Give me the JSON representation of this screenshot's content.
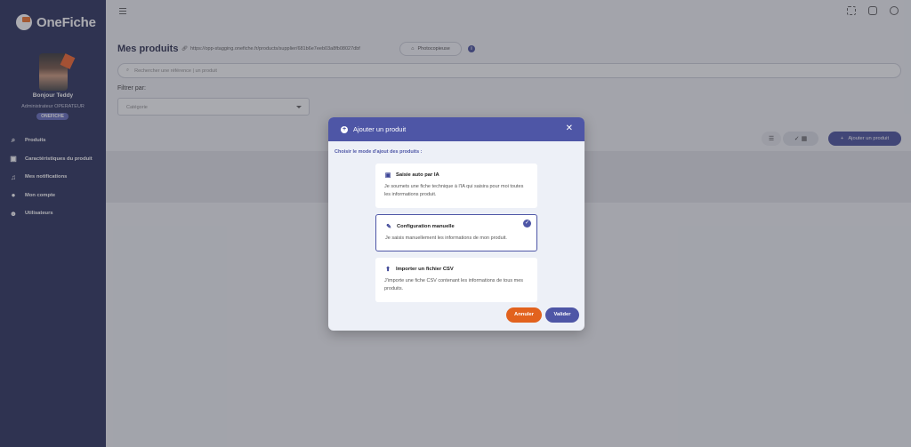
{
  "app": {
    "logo_text": "OneFiche"
  },
  "user": {
    "greeting": "Bonjour Teddy",
    "role": "Administrateur OPERATEUR",
    "company": "ONEFICHE"
  },
  "sidebar": {
    "items": [
      {
        "label": "Produits",
        "icon": "search-icon"
      },
      {
        "label": "Caractéristiques du produit",
        "icon": "box-icon"
      },
      {
        "label": "Mes notifications",
        "icon": "bell-icon"
      },
      {
        "label": "Mon compte",
        "icon": "user-icon"
      },
      {
        "label": "Utilisateurs",
        "icon": "users-icon"
      }
    ]
  },
  "page": {
    "title": "Mes produits",
    "url": "https://opp-stagging.onefiche.fr/products/supplier/681b6e7eeb03a8fb08027dbf",
    "photo_button": "Photocopieuse",
    "search_placeholder": "Rechercher une référence | un produit",
    "filter_label": "Filtrer par:",
    "category_placeholder": "Catégorie",
    "add_button": "Ajouter un produit"
  },
  "modal": {
    "title": "Ajouter un produit",
    "subtitle": "Choisir le mode d'ajout des produits :",
    "options": [
      {
        "title": "Saisie auto par IA",
        "desc": "Je soumets une fiche technique à l'IA qui saisira pour moi toutes les informations produit.",
        "selected": false
      },
      {
        "title": "Configuration manuelle",
        "desc": "Je saisis manuellement les informations de mon produit.",
        "selected": true
      },
      {
        "title": "Importer un fichier CSV",
        "desc": "J'importe une fiche CSV contenant les informations de tous mes produits.",
        "selected": false
      }
    ],
    "cancel_label": "Annuler",
    "validate_label": "Valider"
  },
  "colors": {
    "sidebar": "#1d2450",
    "primary": "#4e56a6",
    "accent": "#e2621e"
  }
}
